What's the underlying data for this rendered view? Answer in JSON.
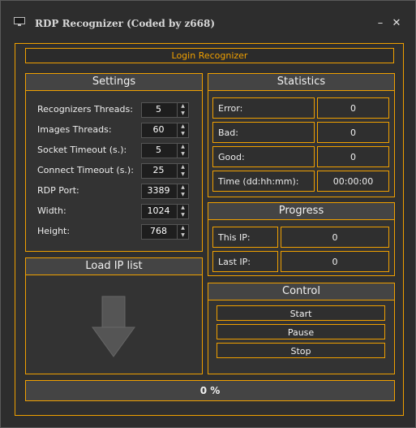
{
  "window": {
    "title": "RDP Recognizer (Coded by z668)",
    "minimize_glyph": "–",
    "close_glyph": "✕"
  },
  "banner": {
    "label": "Login Recognizer"
  },
  "settings": {
    "title": "Settings",
    "fields": [
      {
        "label": "Recognizers Threads:",
        "value": "5"
      },
      {
        "label": "Images Threads:",
        "value": "60"
      },
      {
        "label": "Socket Timeout (s.):",
        "value": "5"
      },
      {
        "label": "Connect Timeout (s.):",
        "value": "25"
      },
      {
        "label": "RDP Port:",
        "value": "3389"
      },
      {
        "label": "Width:",
        "value": "1024"
      },
      {
        "label": "Height:",
        "value": "768"
      }
    ]
  },
  "load_ip": {
    "title": "Load IP list",
    "icon": "down-arrow-icon"
  },
  "statistics": {
    "title": "Statistics",
    "rows": [
      {
        "label": "Error:",
        "value": "0"
      },
      {
        "label": "Bad:",
        "value": "0"
      },
      {
        "label": "Good:",
        "value": "0"
      },
      {
        "label": "Time (dd:hh:mm):",
        "value": "00:00:00"
      }
    ]
  },
  "progress_panel": {
    "title": "Progress",
    "rows": [
      {
        "label": "This IP:",
        "value": "0"
      },
      {
        "label": "Last IP:",
        "value": "0"
      }
    ]
  },
  "control": {
    "title": "Control",
    "start_label": "Start",
    "pause_label": "Pause",
    "stop_label": "Stop"
  },
  "overall_progress": {
    "percent": 0,
    "text": "0 %"
  },
  "colors": {
    "accent": "#f0a000",
    "background": "#2d2d2d",
    "header": "#444444"
  }
}
